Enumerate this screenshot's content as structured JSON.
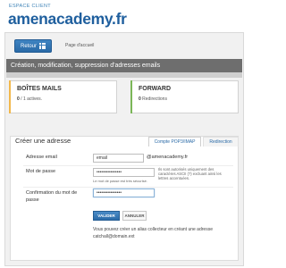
{
  "header": {
    "kicker": "ESPACE CLIENT",
    "brand": "amenacademy.fr"
  },
  "nav": {
    "back_label": "Retour",
    "home_label": "Page d'accueil"
  },
  "section": {
    "title": "Création, modification, suppression d'adresses emails"
  },
  "boxes": {
    "mailboxes": {
      "title": "BOÎTES MAILS",
      "count": "0",
      "of": " / 1 actives.",
      "accent": "#f2b84b"
    },
    "forward": {
      "title": "FORWARD",
      "count": "0",
      "text": " Redirections",
      "accent": "#7bb658"
    }
  },
  "form": {
    "title": "Créer une adresse",
    "tabs": [
      {
        "label": "Compte POP3/IMAP",
        "active": true
      },
      {
        "label": "Redirection",
        "active": false
      }
    ],
    "email_label": "Adresse email",
    "email_value": "email",
    "domain": "@amenacademy.fr",
    "password_label": "Mot de passe",
    "password_value": "••••••••••••••••",
    "password_hint": "Ils sont autorisés uniquement des caractères ASCII (?) excluant ainsi les lettres accentuées.",
    "password_ok": "Le mot de passe est très sécurisé.",
    "confirm_label": "Confirmation du mot de passe",
    "confirm_value": "••••••••••••••••",
    "validate_label": "VALIDER",
    "cancel_label": "ANNULER",
    "catchall_note": "Vous pouvez créer un alias collecteur en créant une adresse catchall@domain.ext"
  }
}
